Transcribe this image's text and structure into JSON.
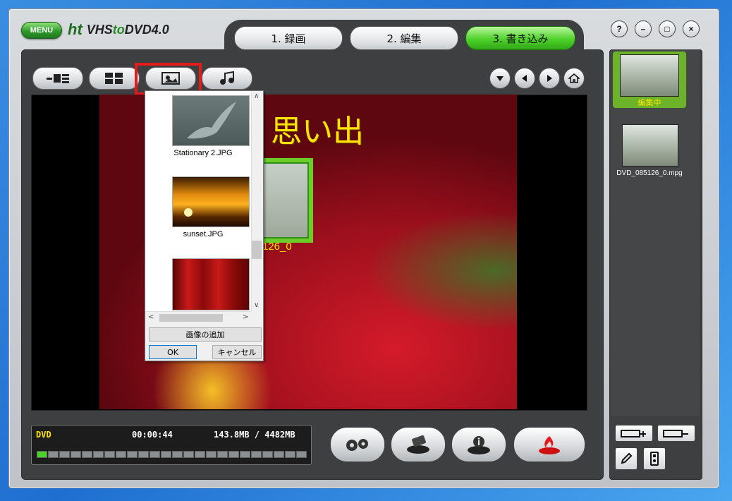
{
  "app": {
    "menu_label": "MENU",
    "logo_prefix": "ht",
    "logo_name_a": "VHS",
    "logo_name_b": "to",
    "logo_name_c": "DVD",
    "logo_version": "4.0"
  },
  "steps": [
    {
      "label": "1. 録画",
      "active": false
    },
    {
      "label": "2. 編集",
      "active": false
    },
    {
      "label": "3. 書き込み",
      "active": true
    }
  ],
  "toolbar": {
    "icons": [
      "chapter-tree-icon",
      "layout-grid-icon",
      "background-image-icon",
      "music-note-icon"
    ],
    "nav_icons": [
      "triangle-down-icon",
      "arrow-left-icon",
      "arrow-right-icon",
      "home-icon"
    ]
  },
  "preview": {
    "title_text": "思い出",
    "thumb_caption": "126_0"
  },
  "picker": {
    "items": [
      {
        "label": "Stationary 2.JPG"
      },
      {
        "label": "sunset.JPG"
      },
      {
        "label": ""
      }
    ],
    "add_button": "画像の追加",
    "ok_button": "OK",
    "cancel_button": "キャンセル"
  },
  "status": {
    "media": "DVD",
    "time": "00:00:44",
    "size": "143.8MB / 4482MB",
    "progress_segments": 24,
    "progress_filled": 1,
    "colors": {
      "media": "#ffe400",
      "text": "#ffffff",
      "progress": "#4cd12a"
    }
  },
  "right_panel": {
    "clips": [
      {
        "label": "編集中",
        "selected": true
      },
      {
        "label": "DVD_085126_0.mpg",
        "selected": false
      }
    ],
    "selected_label_color": "#ffe400"
  },
  "window_controls": [
    "?",
    "–",
    "□",
    "×"
  ]
}
